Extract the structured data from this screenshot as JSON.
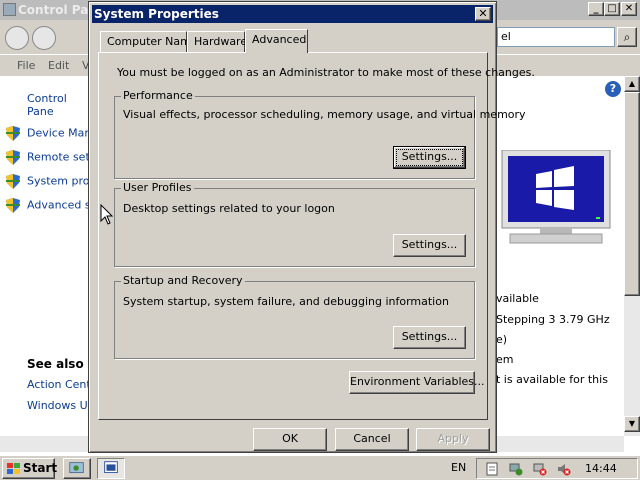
{
  "background_window": {
    "title": "Control Panel",
    "address_text": "el",
    "menu": [
      "File",
      "Edit",
      "V"
    ],
    "left_pane": {
      "home_link": "Control Pane",
      "tasks": [
        {
          "label": "Device Mana",
          "icon": "shield-icon"
        },
        {
          "label": "Remote setti",
          "icon": "shield-icon"
        },
        {
          "label": "System prote",
          "icon": "shield-icon"
        },
        {
          "label": "Advanced sy",
          "icon": "shield-icon"
        }
      ],
      "see_also_heading": "See also",
      "see_also_links": [
        "Action Cente",
        "Windows Up"
      ]
    },
    "right_pane": {
      "lines": [
        "vailable",
        "Stepping 3   3.79 GHz",
        "e)",
        "em",
        "t is available for this"
      ]
    }
  },
  "dialog": {
    "title": "System Properties",
    "close_label": "✕",
    "tabs": [
      {
        "label": "Computer Name",
        "active": false
      },
      {
        "label": "Hardware",
        "active": false
      },
      {
        "label": "Advanced",
        "active": true
      }
    ],
    "admin_note": "You must be logged on as an Administrator to make most of these changes.",
    "groups": [
      {
        "name": "Performance",
        "description": "Visual effects, processor scheduling, memory usage, and virtual memory",
        "button": "Settings...",
        "focused": true
      },
      {
        "name": "User Profiles",
        "description": "Desktop settings related to your logon",
        "button": "Settings...",
        "focused": false
      },
      {
        "name": "Startup and Recovery",
        "description": "System startup, system failure, and debugging information",
        "button": "Settings...",
        "focused": false
      }
    ],
    "env_button": "Environment Variables...",
    "ok_button": "OK",
    "cancel_button": "Cancel",
    "apply_button": "Apply",
    "apply_enabled": false
  },
  "taskbar": {
    "start_label": "Start",
    "language": "EN",
    "clock": "14:44"
  },
  "colors": {
    "title_active": "#0a246a",
    "face": "#d4d0c8",
    "link": "#0b3d91"
  }
}
